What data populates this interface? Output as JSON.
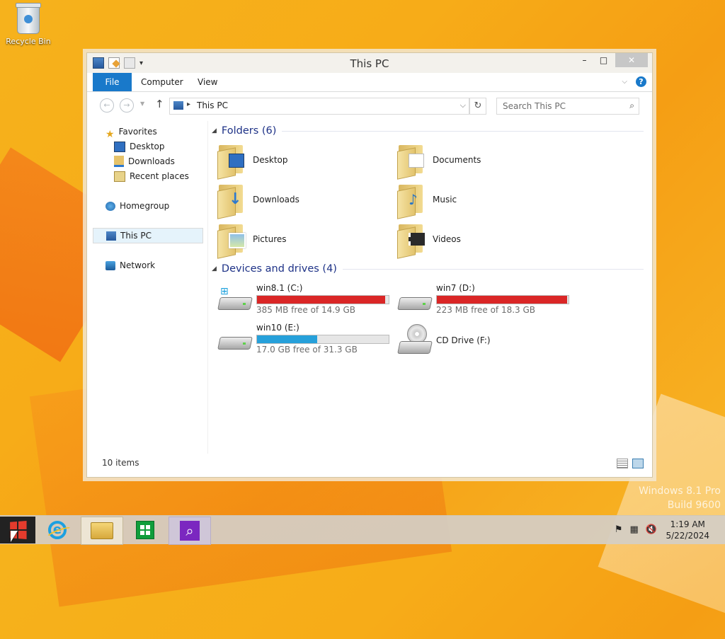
{
  "desktop": {
    "recycle_bin_label": "Recycle Bin",
    "watermark_line1": "Windows 8.1 Pro",
    "watermark_line2": "Build 9600"
  },
  "window": {
    "title": "This PC",
    "controls": {
      "minimize": "–",
      "maximize": "□",
      "close": "✕"
    }
  },
  "ribbon": {
    "tabs": [
      "File",
      "Computer",
      "View"
    ],
    "help": "?"
  },
  "address_bar": {
    "path": "This PC",
    "search_placeholder": "Search This PC"
  },
  "nav_pane": {
    "favorites": "Favorites",
    "favorites_items": [
      "Desktop",
      "Downloads",
      "Recent places"
    ],
    "homegroup": "Homegroup",
    "this_pc": "This PC",
    "network": "Network"
  },
  "content": {
    "folders_header": "Folders (6)",
    "folders": [
      "Desktop",
      "Documents",
      "Downloads",
      "Music",
      "Pictures",
      "Videos"
    ],
    "drives_header": "Devices and drives (4)",
    "drives": [
      {
        "name": "win8.1 (C:)",
        "free": "385 MB free of 14.9 GB",
        "used_fraction": 0.975,
        "color": "#da2626"
      },
      {
        "name": "win7 (D:)",
        "free": "223 MB free of 18.3 GB",
        "used_fraction": 0.988,
        "color": "#da2626"
      },
      {
        "name": "win10 (E:)",
        "free": "17.0 GB free of 31.3 GB",
        "used_fraction": 0.457,
        "color": "#26a0da"
      },
      {
        "name": "CD Drive (F:)"
      }
    ]
  },
  "status_bar": {
    "items_count": "10 items"
  },
  "taskbar": {
    "time": "1:19 AM",
    "date": "5/22/2024"
  }
}
